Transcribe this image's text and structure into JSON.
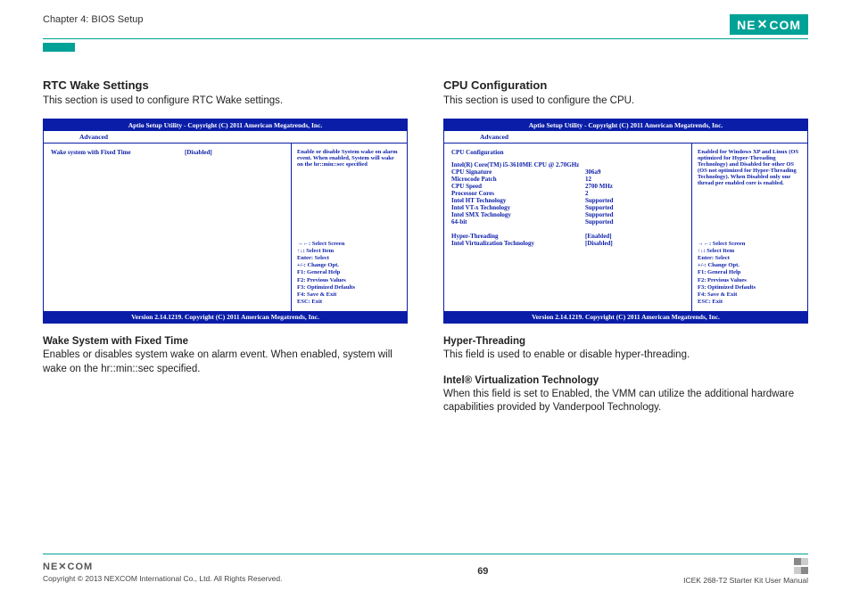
{
  "header": {
    "chapter": "Chapter 4: BIOS Setup",
    "logo_text": "NEXCOM"
  },
  "left": {
    "title": "RTC Wake Settings",
    "desc": "This section is used to configure RTC Wake settings.",
    "bios": {
      "header": "Aptio Setup Utility - Copyright (C) 2011 American Megatrends, Inc.",
      "tab": "Advanced",
      "row1_label": "Wake system with Fixed Time",
      "row1_value": "[Disabled]",
      "help_text": "Enable or disable System wake on alarm event. When enabled, System will wake on the hr::min::sec specified",
      "keys": {
        "k1": "→←: Select Screen",
        "k2": "↑↓: Select Item",
        "k3": "Enter: Select",
        "k4": "+/-: Change Opt.",
        "k5": "F1: General Help",
        "k6": "F2: Previous Values",
        "k7": "F3: Optimized Defaults",
        "k8": "F4: Save & Exit",
        "k9": "ESC: Exit"
      },
      "footer": "Version 2.14.1219. Copyright (C) 2011 American Megatrends, Inc."
    },
    "sub1_title": "Wake System with Fixed Time",
    "sub1_desc": "Enables or disables system wake on alarm event. When enabled, system will wake on the hr::min::sec specified."
  },
  "right": {
    "title": "CPU Configuration",
    "desc": "This section is used to configure the CPU.",
    "bios": {
      "header": "Aptio Setup Utility - Copyright (C) 2011 American Megatrends, Inc.",
      "tab": "Advanced",
      "cfg_title": "CPU Configuration",
      "cpu_line": "Intel(R) Core(TM) i5-3610ME CPU @ 2.70GHz",
      "rows": [
        {
          "k": "CPU Signature",
          "v": "306a9"
        },
        {
          "k": "Microcode Patch",
          "v": "12"
        },
        {
          "k": "CPU Speed",
          "v": "2700 MHz"
        },
        {
          "k": "Processor Cores",
          "v": "2"
        },
        {
          "k": "Intel HT Technology",
          "v": "Supported"
        },
        {
          "k": "Intel VT-x Technology",
          "v": "Supported"
        },
        {
          "k": "Intel SMX Technology",
          "v": "Supported"
        },
        {
          "k": "64-bit",
          "v": "Supported"
        }
      ],
      "opt1_label": "Hyper-Threading",
      "opt1_value": "[Enabled]",
      "opt2_label": "Intel Virtualization Technology",
      "opt2_value": "[Disabled]",
      "help_text": "Enabled for Windows XP and Linux (OS optimized for Hyper-Threading Technology) and Disabled for other OS (OS not optimized for Hyper-Threading Technology). When Disabled only one thread per enabled core is enabled.",
      "keys": {
        "k1": "→←: Select Screen",
        "k2": "↑↓: Select Item",
        "k3": "Enter: Select",
        "k4": "+/-: Change Opt.",
        "k5": "F1: General Help",
        "k6": "F2: Previous Values",
        "k7": "F3: Optimized Defaults",
        "k8": "F4: Save & Exit",
        "k9": "ESC: Exit"
      },
      "footer": "Version 2.14.1219. Copyright (C) 2011 American Megatrends, Inc."
    },
    "sub1_title": "Hyper-Threading",
    "sub1_desc": "This field is used to enable or disable hyper-threading.",
    "sub2_title": "Intel® Virtualization Technology",
    "sub2_desc": "When this field is set to Enabled, the VMM can utilize the additional hardware capabilities provided by Vanderpool Technology."
  },
  "footer": {
    "logo": "NEXCOM",
    "copyright": "Copyright © 2013 NEXCOM International Co., Ltd. All Rights Reserved.",
    "page": "69",
    "manual": "ICEK 268-T2 Starter Kit User Manual"
  }
}
